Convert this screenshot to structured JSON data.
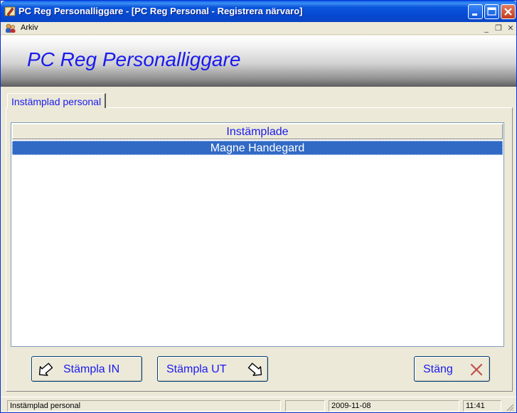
{
  "window": {
    "title": "PC Reg Personalliggare - [PC Reg Personal - Registrera närvaro]"
  },
  "menubar": {
    "items": [
      {
        "label": "Arkiv"
      }
    ],
    "mdi": {
      "minimize": "_",
      "restore": "❐",
      "close": "✕"
    }
  },
  "banner": {
    "title": "PC Reg Personalliggare",
    "title_color": "#1a1aee"
  },
  "tab": {
    "label": "Instämplad personal"
  },
  "list": {
    "header": "Instämplade",
    "rows": [
      {
        "name": "Magne Handegard",
        "selected": true
      }
    ]
  },
  "buttons": {
    "stamp_in": {
      "label": "Stämpla IN",
      "icon": "arrow-in-icon"
    },
    "stamp_out": {
      "label": "Stämpla UT",
      "icon": "arrow-out-icon"
    },
    "close": {
      "label": "Stäng",
      "icon": "close-x-icon"
    }
  },
  "statusbar": {
    "message": "Instämplad personal",
    "empty": "",
    "date": "2009-11-08",
    "time": "11:41"
  },
  "colors": {
    "selection": "#316ac5",
    "accent_text": "#1a1aee",
    "titlebar": "#0a5fe8"
  }
}
